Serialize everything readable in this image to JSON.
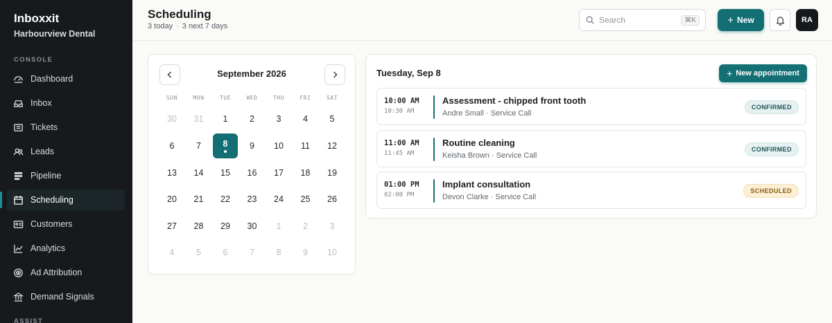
{
  "sidebar": {
    "brand": "Inboxxit",
    "org": "Harbourview Dental",
    "console_label": "CONSOLE",
    "assist_label": "ASSIST",
    "items": [
      {
        "label": "Dashboard",
        "icon": "dashboard-icon"
      },
      {
        "label": "Inbox",
        "icon": "inbox-icon"
      },
      {
        "label": "Tickets",
        "icon": "ticket-icon"
      },
      {
        "label": "Leads",
        "icon": "users-icon"
      },
      {
        "label": "Pipeline",
        "icon": "pipeline-icon"
      },
      {
        "label": "Scheduling",
        "icon": "calendar-icon",
        "active": true
      },
      {
        "label": "Customers",
        "icon": "id-card-icon"
      },
      {
        "label": "Analytics",
        "icon": "chart-line-icon"
      },
      {
        "label": "Ad Attribution",
        "icon": "target-icon"
      },
      {
        "label": "Demand Signals",
        "icon": "bank-icon"
      }
    ]
  },
  "header": {
    "title": "Scheduling",
    "today": "3 today",
    "next": "3 next 7 days",
    "search_placeholder": "Search",
    "search_shortcut": "⌘K",
    "new_label": "New",
    "avatar_initials": "RA"
  },
  "calendar": {
    "month": "September 2026",
    "weekdays": [
      "SUN",
      "MON",
      "TUE",
      "WED",
      "THU",
      "FRI",
      "SAT"
    ],
    "weeks": [
      [
        {
          "d": "30",
          "m": true
        },
        {
          "d": "31",
          "m": true
        },
        {
          "d": "1"
        },
        {
          "d": "2"
        },
        {
          "d": "3"
        },
        {
          "d": "4"
        },
        {
          "d": "5"
        }
      ],
      [
        {
          "d": "6"
        },
        {
          "d": "7"
        },
        {
          "d": "8",
          "sel": true
        },
        {
          "d": "9"
        },
        {
          "d": "10"
        },
        {
          "d": "11"
        },
        {
          "d": "12"
        }
      ],
      [
        {
          "d": "13"
        },
        {
          "d": "14"
        },
        {
          "d": "15"
        },
        {
          "d": "16"
        },
        {
          "d": "17"
        },
        {
          "d": "18"
        },
        {
          "d": "19"
        }
      ],
      [
        {
          "d": "20"
        },
        {
          "d": "21"
        },
        {
          "d": "22"
        },
        {
          "d": "23"
        },
        {
          "d": "24"
        },
        {
          "d": "25"
        },
        {
          "d": "26"
        }
      ],
      [
        {
          "d": "27"
        },
        {
          "d": "28"
        },
        {
          "d": "29"
        },
        {
          "d": "30"
        },
        {
          "d": "1",
          "m": true
        },
        {
          "d": "2",
          "m": true
        },
        {
          "d": "3",
          "m": true
        }
      ],
      [
        {
          "d": "4",
          "m": true
        },
        {
          "d": "5",
          "m": true
        },
        {
          "d": "6",
          "m": true
        },
        {
          "d": "7",
          "m": true
        },
        {
          "d": "8",
          "m": true
        },
        {
          "d": "9",
          "m": true
        },
        {
          "d": "10",
          "m": true
        }
      ]
    ]
  },
  "appointments": {
    "date_heading": "Tuesday, Sep 8",
    "new_label": "New appointment",
    "items": [
      {
        "start": "10:00 AM",
        "end": "10:30 AM",
        "title": "Assessment - chipped front tooth",
        "meta": "Andre Small · Service Call",
        "status": "CONFIRMED",
        "status_kind": "confirmed"
      },
      {
        "start": "11:00 AM",
        "end": "11:45 AM",
        "title": "Routine cleaning",
        "meta": "Keisha Brown · Service Call",
        "status": "CONFIRMED",
        "status_kind": "confirmed"
      },
      {
        "start": "01:00 PM",
        "end": "02:00 PM",
        "title": "Implant consultation",
        "meta": "Devon Clarke · Service Call",
        "status": "SCHEDULED",
        "status_kind": "scheduled"
      }
    ]
  },
  "colors": {
    "accent": "#136f74",
    "sidebar_bg": "#161a1d",
    "confirmed_bg": "#e6f1f1",
    "scheduled_bg": "#fcefd6"
  }
}
